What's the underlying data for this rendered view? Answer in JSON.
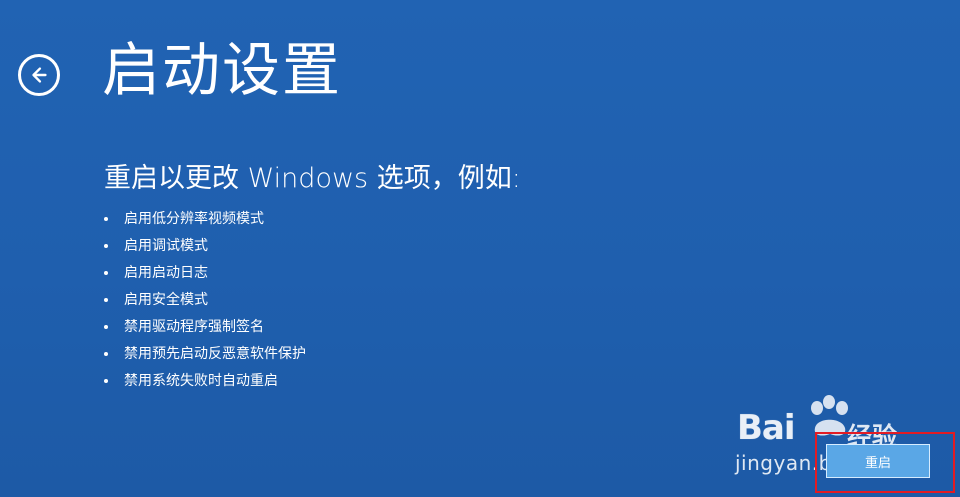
{
  "page": {
    "title": "启动设置",
    "subtitle": "重启以更改 Windows 选项，例如:",
    "options": [
      "启用低分辨率视频模式",
      "启用调试模式",
      "启用启动日志",
      "启用安全模式",
      "禁用驱动程序强制签名",
      "禁用预先启动反恶意软件保护",
      "禁用系统失败时自动重启"
    ]
  },
  "actions": {
    "restart_label": "重启"
  },
  "watermark": {
    "brand": "Bai",
    "brand_cn": "经验",
    "domain": "jingyan.baidu.com"
  },
  "colors": {
    "background": "#1f5fae",
    "button": "#5aa7e6",
    "highlight": "#e31b23",
    "text": "#ffffff"
  },
  "icons": {
    "back": "back-arrow-icon",
    "paw": "paw-icon",
    "bullet": "bullet-icon"
  }
}
